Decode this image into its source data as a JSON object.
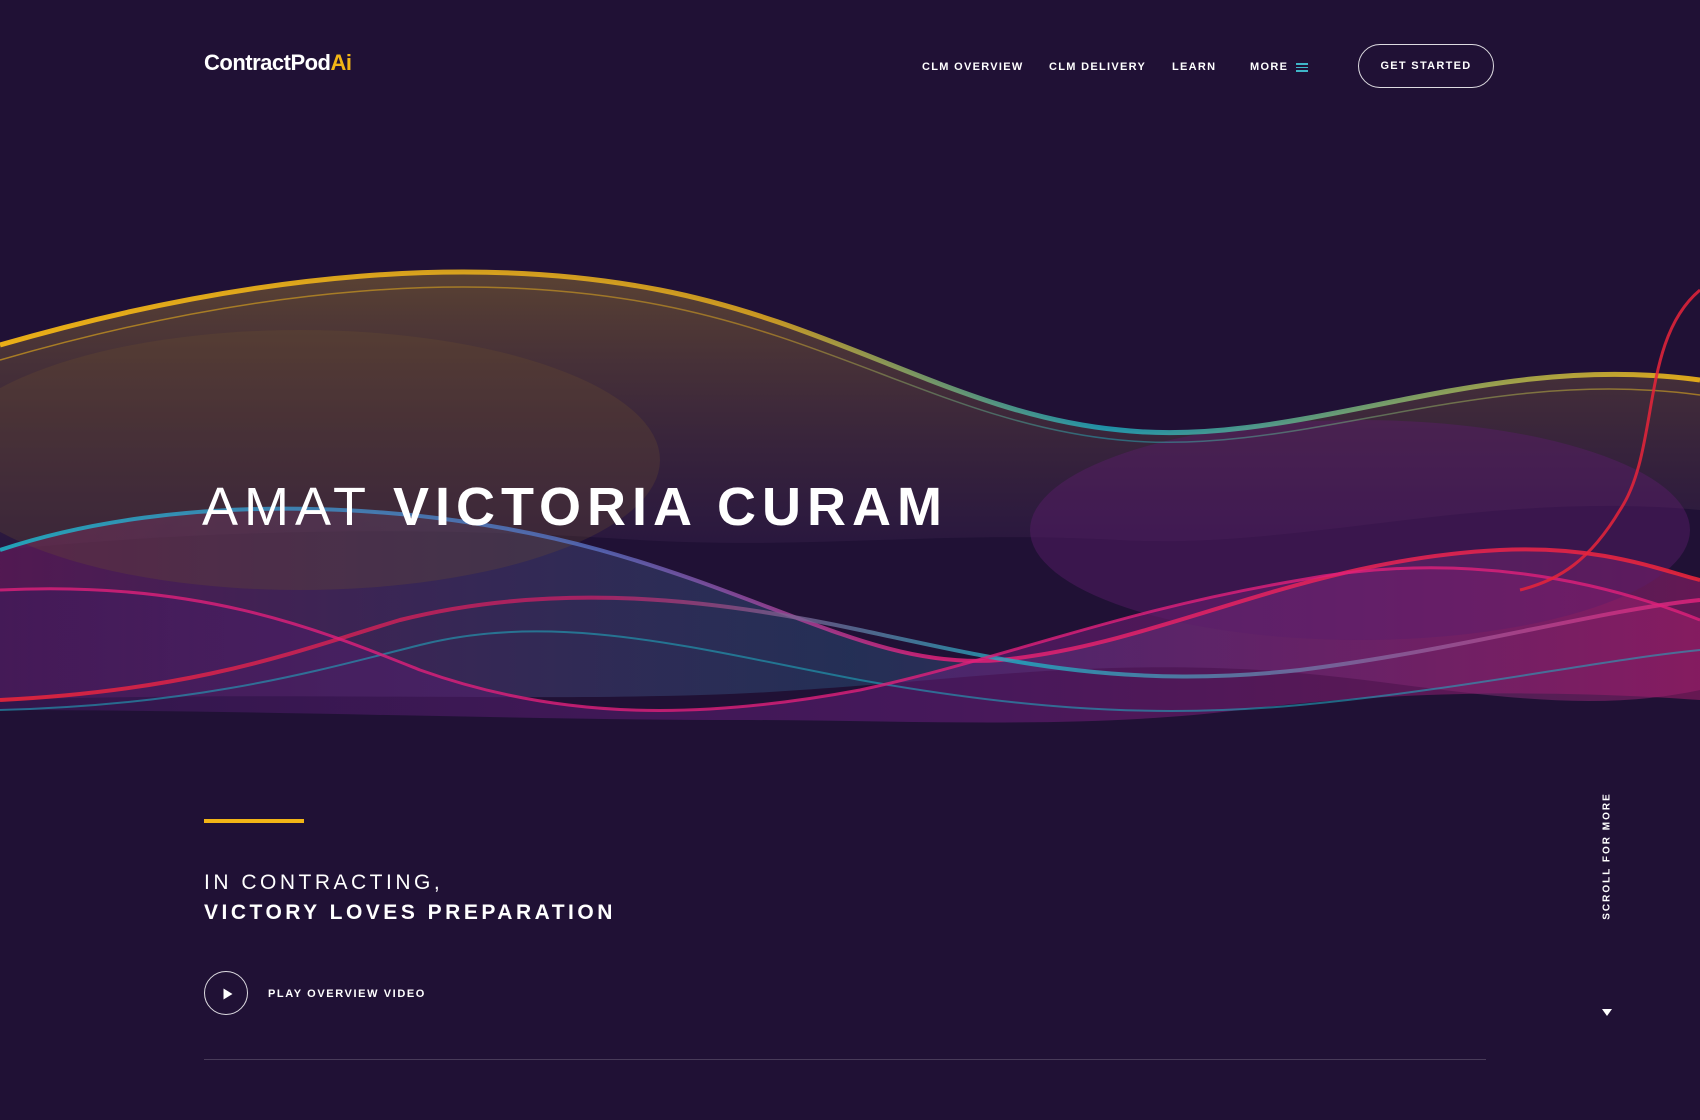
{
  "header": {
    "logo_text": "ContractPod",
    "logo_accent": "Ai",
    "nav": [
      {
        "label": "CLM OVERVIEW"
      },
      {
        "label": "CLM DELIVERY"
      },
      {
        "label": "LEARN"
      },
      {
        "label": "MORE",
        "icon": "hamburger-menu-icon"
      }
    ],
    "cta_label": "GET STARTED"
  },
  "hero": {
    "title_light": "AMAT",
    "title_bold": "VICTORIA CURAM",
    "subtitle_line1": "IN CONTRACTING,",
    "subtitle_line2": "VICTORY LOVES PREPARATION",
    "play_label": "PLAY OVERVIEW VIDEO",
    "play_icon": "play-icon"
  },
  "scroll": {
    "label": "SCROLL FOR MORE",
    "icon": "caret-down-icon"
  },
  "colors": {
    "background": "#201135",
    "accent_yellow": "#f2b516",
    "wave_teal": "#1fb0c4",
    "wave_magenta": "#e0217a",
    "wave_purple": "#6b2c8c",
    "wave_red": "#e8253a"
  }
}
